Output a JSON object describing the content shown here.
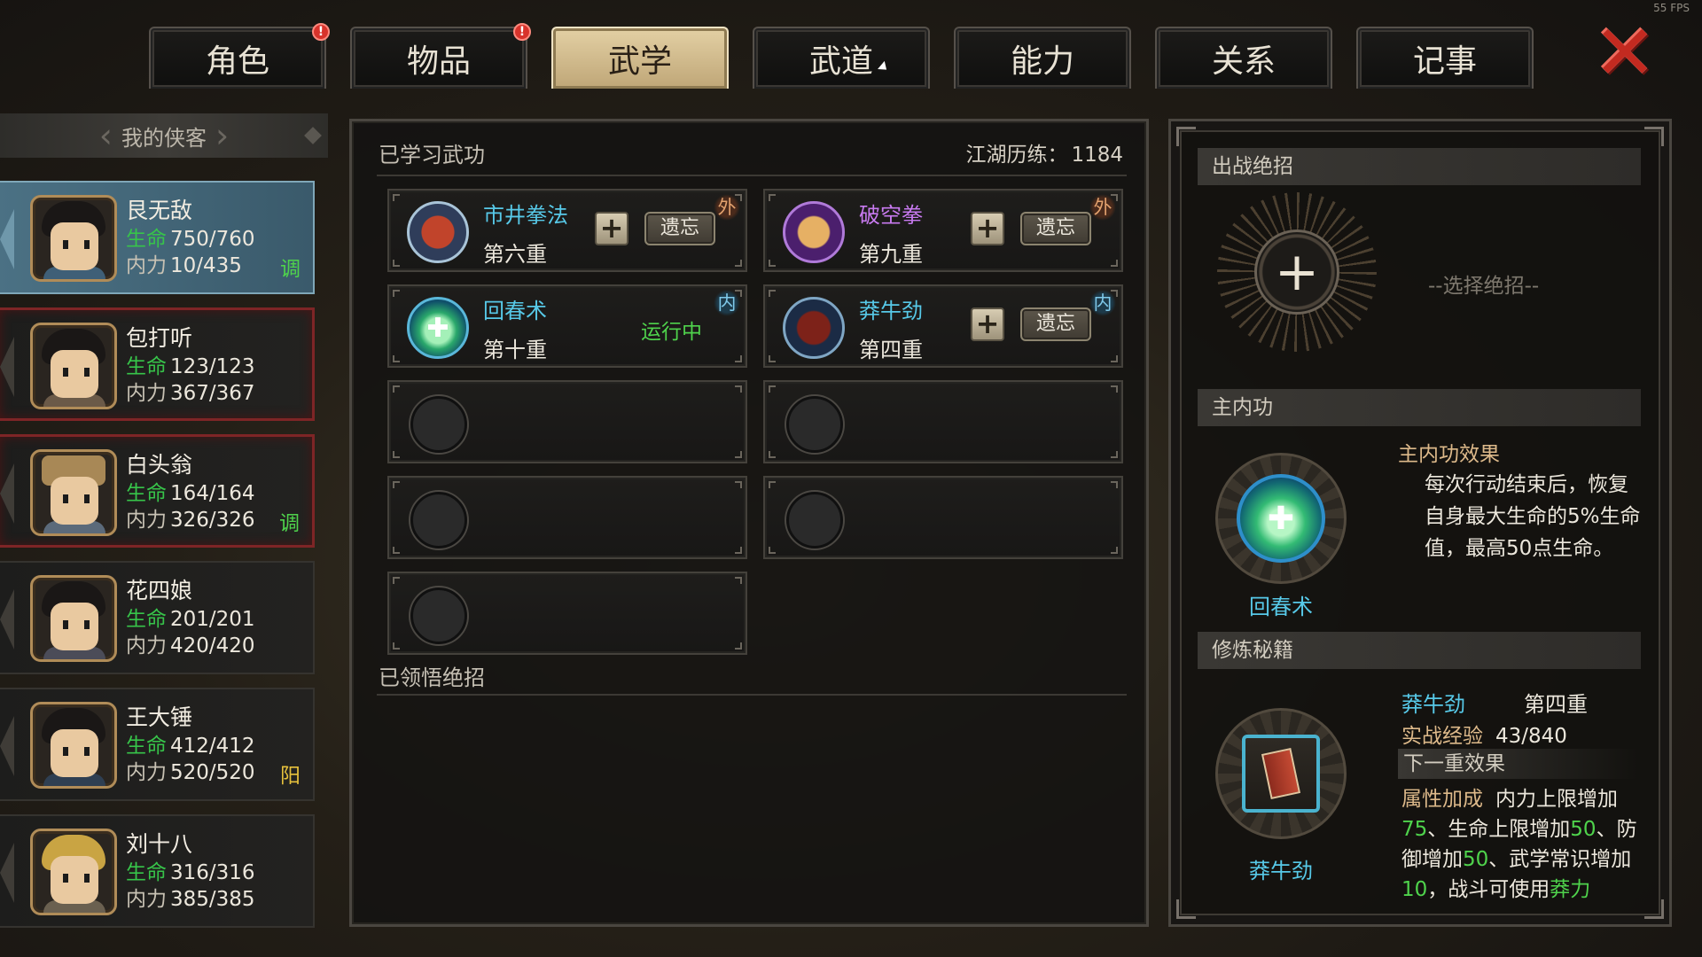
{
  "fps": "55 FPS",
  "tabs": [
    {
      "label": "角色",
      "alert": "!"
    },
    {
      "label": "物品",
      "alert": "!"
    },
    {
      "label": "武学",
      "alert": ""
    },
    {
      "label": "武道",
      "alert": ""
    },
    {
      "label": "能力",
      "alert": ""
    },
    {
      "label": "关系",
      "alert": ""
    },
    {
      "label": "记事",
      "alert": ""
    }
  ],
  "active_tab": "武学",
  "close_glyph": "✕",
  "roster": {
    "title": "我的侠客",
    "characters": [
      {
        "name": "艮无敌",
        "hp_label": "生命",
        "hp": "750/760",
        "mp_label": "内力",
        "mp": "10/435",
        "tag": "调",
        "tag_color": "#4fd34c"
      },
      {
        "name": "包打听",
        "hp_label": "生命",
        "hp": "123/123",
        "mp_label": "内力",
        "mp": "367/367",
        "tag": "",
        "tag_color": ""
      },
      {
        "name": "白头翁",
        "hp_label": "生命",
        "hp": "164/164",
        "mp_label": "内力",
        "mp": "326/326",
        "tag": "调",
        "tag_color": "#4fd34c"
      },
      {
        "name": "花四娘",
        "hp_label": "生命",
        "hp": "201/201",
        "mp_label": "内力",
        "mp": "420/420",
        "tag": "",
        "tag_color": ""
      },
      {
        "name": "王大锤",
        "hp_label": "生命",
        "hp": "412/412",
        "mp_label": "内力",
        "mp": "520/520",
        "tag": "阳",
        "tag_color": "#e6c13c"
      },
      {
        "name": "刘十八",
        "hp_label": "生命",
        "hp": "316/316",
        "mp_label": "内力",
        "mp": "385/385",
        "tag": "",
        "tag_color": ""
      }
    ]
  },
  "learned": {
    "title": "已学习武功",
    "exp_label": "江湖历练：",
    "exp_value": "1184",
    "skills": [
      {
        "name": "市井拳法",
        "name_color": "#57c9e8",
        "level": "第六重",
        "type": "外",
        "plus": "+",
        "forget": "遗忘",
        "running": "",
        "icon": "fist-icon"
      },
      {
        "name": "破空拳",
        "name_color": "#c87af0",
        "level": "第九重",
        "type": "外",
        "plus": "+",
        "forget": "遗忘",
        "running": "",
        "icon": "palm-strike-icon"
      },
      {
        "name": "回春术",
        "name_color": "#57c9e8",
        "level": "第十重",
        "type": "内",
        "plus": "",
        "forget": "",
        "running": "运行中",
        "icon": "healing-icon"
      },
      {
        "name": "莽牛劲",
        "name_color": "#57c9e8",
        "level": "第四重",
        "type": "内",
        "plus": "+",
        "forget": "遗忘",
        "running": "",
        "icon": "bull-icon"
      }
    ],
    "enlightened_title": "已领悟绝招"
  },
  "right": {
    "ultimate_title": "出战绝招",
    "ultimate_plus": "+",
    "ultimate_hint": "--选择绝招--",
    "main_internal_title": "主内功",
    "effect_title": "主内功效果",
    "effect_text": "每次行动结束后，恢复自身最大生命的5%生命值，最高50点生命。",
    "main_internal_name": "回春术",
    "manual_title": "修炼秘籍",
    "manual_name": "莽牛劲",
    "manual_level": "第四重",
    "manual_exp_label": "实战经验",
    "manual_exp": "43/840",
    "next_effect_title": "下一重效果",
    "bonus_label": "属性加成",
    "bonus_parts": [
      "内力上限增加",
      "75",
      "、生命上限增加",
      "50",
      "、防御增加",
      "50",
      "、武学常识增加",
      "10",
      "，战斗可使用",
      "莽力"
    ],
    "manual_caption": "莽牛劲"
  }
}
